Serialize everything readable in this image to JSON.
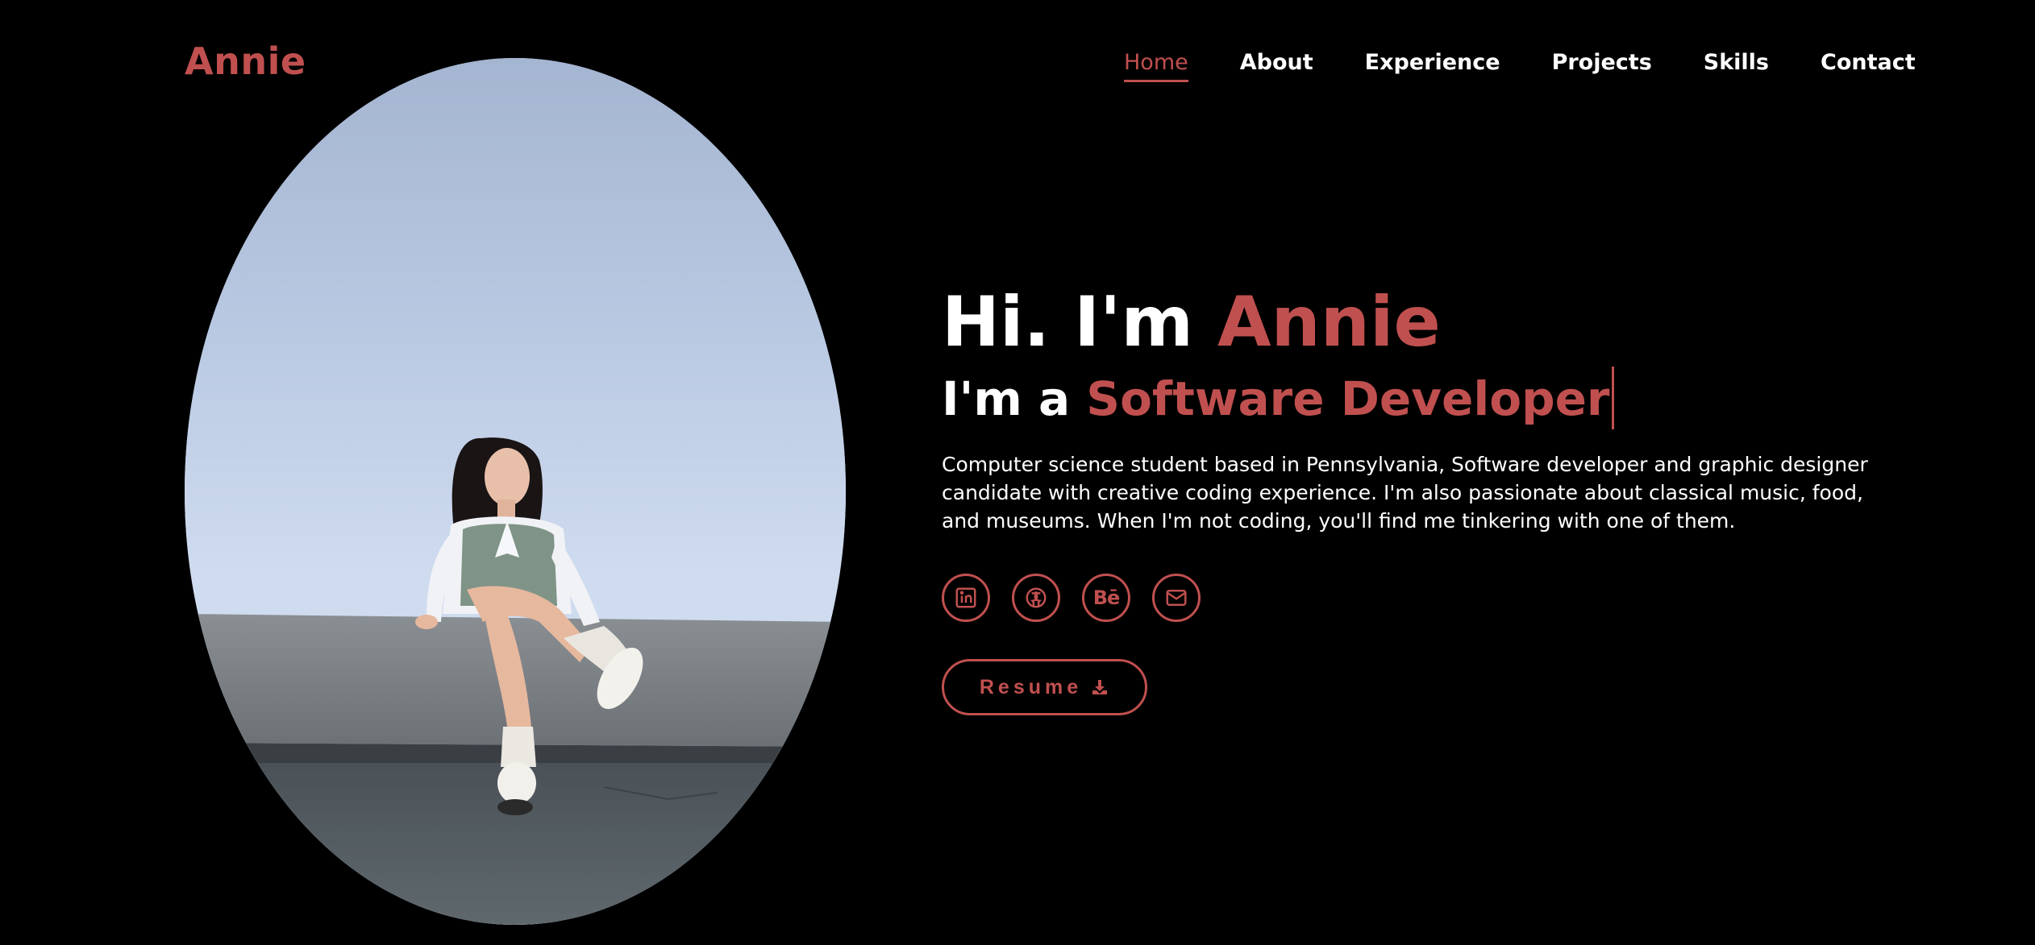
{
  "header": {
    "logo": "Annie",
    "nav": [
      {
        "label": "Home",
        "active": true
      },
      {
        "label": "About",
        "active": false
      },
      {
        "label": "Experience",
        "active": false
      },
      {
        "label": "Projects",
        "active": false
      },
      {
        "label": "Skills",
        "active": false
      },
      {
        "label": "Contact",
        "active": false
      }
    ]
  },
  "hero": {
    "greeting": "Hi. I'm ",
    "name": "Annie",
    "sub_prefix": "I'm a ",
    "role": "Software Developer",
    "description": "Computer science student based in Pennsylvania, Software developer and graphic designer candidate with creative coding experience. I'm also passionate about classical music, food, and museums. When I'm not coding, you'll find me tinkering with one of them.",
    "socials": [
      {
        "icon": "linkedin-icon"
      },
      {
        "icon": "github-icon"
      },
      {
        "icon": "behance-icon",
        "glyph": "Bē"
      },
      {
        "icon": "mail-icon"
      }
    ],
    "resume_label": "Resume",
    "resume_icon": "download-icon"
  },
  "photo": {
    "subject": "portrait-photo"
  },
  "colors": {
    "accent": "#c0504f",
    "background": "#000000",
    "text": "#ffffff"
  }
}
